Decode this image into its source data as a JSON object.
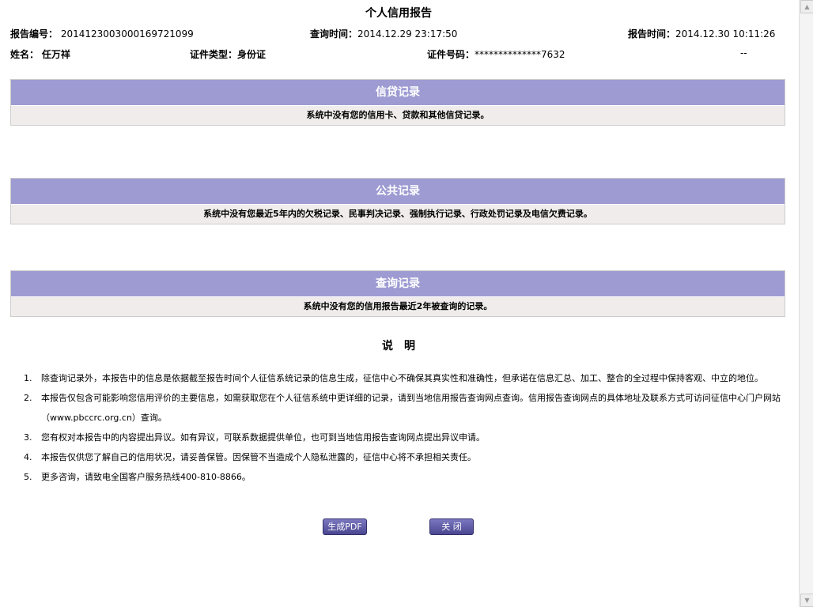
{
  "title": "个人信用报告",
  "header": {
    "report_no_label": "报告编号：",
    "report_no": "2014123003000169721099",
    "query_time_label": "查询时间：",
    "query_time": "2014.12.29 23:17:50",
    "report_time_label": "报告时间：",
    "report_time": "2014.12.30 10:11:26",
    "name_label": "姓名：",
    "name": "任万祥",
    "id_type_label": "证件类型：",
    "id_type": "身份证",
    "id_no_label": "证件号码：",
    "id_no": "**************7632",
    "extra": "--"
  },
  "sections": [
    {
      "title": "信贷记录",
      "body": "系统中没有您的信用卡、贷款和其他信贷记录。"
    },
    {
      "title": "公共记录",
      "body": "系统中没有您最近5年内的欠税记录、民事判决记录、强制执行记录、行政处罚记录及电信欠费记录。"
    },
    {
      "title": "查询记录",
      "body": "系统中没有您的信用报告最近2年被查询的记录。"
    }
  ],
  "notes_title": "说　明",
  "notes": [
    {
      "n": "1.",
      "text": "除查询记录外，本报告中的信息是依据截至报告时间个人征信系统记录的信息生成，征信中心不确保其真实性和准确性，但承诺在信息汇总、加工、整合的全过程中保持客观、中立的地位。"
    },
    {
      "n": "2.",
      "text": "本报告仅包含可能影响您信用评价的主要信息，如需获取您在个人征信系统中更详细的记录，请到当地信用报告查询网点查询。信用报告查询网点的具体地址及联系方式可访问征信中心门户网站（www.pbccrc.org.cn）查询。"
    },
    {
      "n": "3.",
      "text": "您有权对本报告中的内容提出异议。如有异议，可联系数据提供单位，也可到当地信用报告查询网点提出异议申请。"
    },
    {
      "n": "4.",
      "text": "本报告仅供您了解自己的信用状况，请妥善保管。因保管不当造成个人隐私泄露的，征信中心将不承担相关责任。"
    },
    {
      "n": "5.",
      "text": "更多咨询，请致电全国客户服务热线400-810-8866。"
    }
  ],
  "buttons": {
    "pdf": "生成PDF",
    "close": "关 闭"
  }
}
